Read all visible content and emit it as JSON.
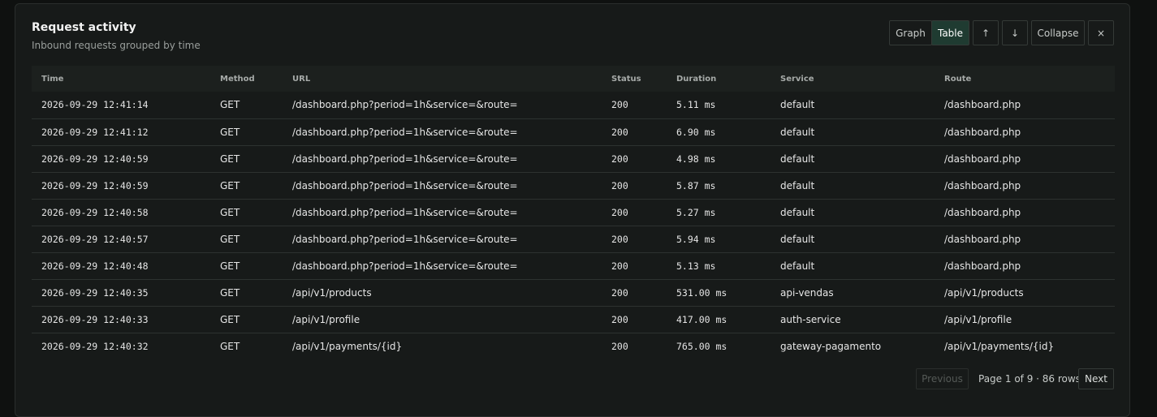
{
  "header": {
    "title": "Request activity",
    "subtitle": "Inbound requests grouped by time"
  },
  "toolbar": {
    "graph_label": "Graph",
    "table_label": "Table",
    "move_up_icon": "↑",
    "move_down_icon": "↓",
    "collapse_label": "Collapse",
    "close_icon": "×",
    "active_view": "Table"
  },
  "table": {
    "columns": [
      "Time",
      "Method",
      "URL",
      "Status",
      "Duration",
      "Service",
      "Route"
    ],
    "rows": [
      [
        "2026-09-29 12:41:14",
        "GET",
        "/dashboard.php?period=1h&service=&route=",
        "200",
        "5.11 ms",
        "default",
        "/dashboard.php"
      ],
      [
        "2026-09-29 12:41:12",
        "GET",
        "/dashboard.php?period=1h&service=&route=",
        "200",
        "6.90 ms",
        "default",
        "/dashboard.php"
      ],
      [
        "2026-09-29 12:40:59",
        "GET",
        "/dashboard.php?period=1h&service=&route=",
        "200",
        "4.98 ms",
        "default",
        "/dashboard.php"
      ],
      [
        "2026-09-29 12:40:59",
        "GET",
        "/dashboard.php?period=1h&service=&route=",
        "200",
        "5.87 ms",
        "default",
        "/dashboard.php"
      ],
      [
        "2026-09-29 12:40:58",
        "GET",
        "/dashboard.php?period=1h&service=&route=",
        "200",
        "5.27 ms",
        "default",
        "/dashboard.php"
      ],
      [
        "2026-09-29 12:40:57",
        "GET",
        "/dashboard.php?period=1h&service=&route=",
        "200",
        "5.94 ms",
        "default",
        "/dashboard.php"
      ],
      [
        "2026-09-29 12:40:48",
        "GET",
        "/dashboard.php?period=1h&service=&route=",
        "200",
        "5.13 ms",
        "default",
        "/dashboard.php"
      ],
      [
        "2026-09-29 12:40:35",
        "GET",
        "/api/v1/products",
        "200",
        "531.00 ms",
        "api-vendas",
        "/api/v1/products"
      ],
      [
        "2026-09-29 12:40:33",
        "GET",
        "/api/v1/profile",
        "200",
        "417.00 ms",
        "auth-service",
        "/api/v1/profile"
      ],
      [
        "2026-09-29 12:40:32",
        "GET",
        "/api/v1/payments/{id}",
        "200",
        "765.00 ms",
        "gateway-pagamento",
        "/api/v1/payments/{id}"
      ]
    ]
  },
  "pagination": {
    "previous_label": "Previous",
    "info": "Page 1 of 9 · 86 rows",
    "next_label": "Next"
  },
  "colors": {
    "background": "#0f1110",
    "panel": "#171a19",
    "active_tab": "#1f3b31",
    "border": "#2d3230"
  }
}
